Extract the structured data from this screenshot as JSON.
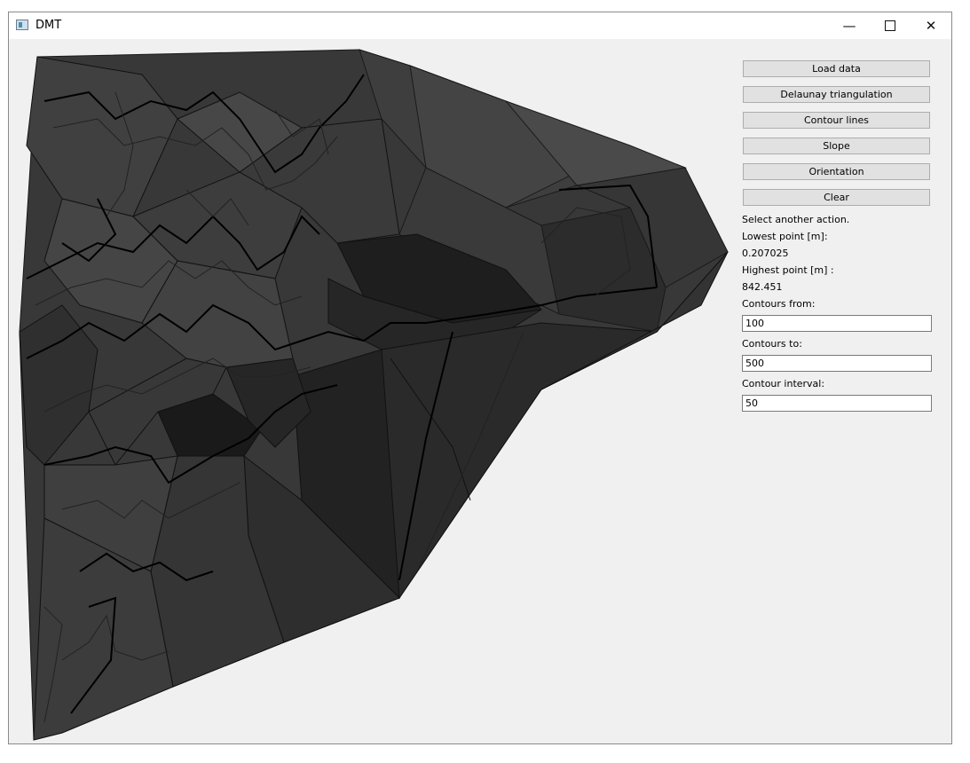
{
  "window": {
    "title": "DMT",
    "icon": "app-window-icon"
  },
  "controls": {
    "minimize_icon": "minimize-icon",
    "maximize_icon": "maximize-icon",
    "close_icon": "close-icon"
  },
  "buttons": {
    "load_data": "Load data",
    "delaunay": "Delaunay triangulation",
    "contours": "Contour lines",
    "slope": "Slope",
    "orientation": "Orientation",
    "clear": "Clear"
  },
  "status": "Select another action.",
  "lowest": {
    "label": "Lowest point [m]:",
    "value": "0.207025"
  },
  "highest": {
    "label": "Highest point [m] :",
    "value": "842.451"
  },
  "contours_from": {
    "label": "Contours from:",
    "value": "100"
  },
  "contours_to": {
    "label": "Contours to:",
    "value": "500"
  },
  "contour_interval": {
    "label": "Contour interval:",
    "value": "50"
  },
  "colors": {
    "background": "#f0f0f0",
    "terrain_dark": "#1c1c1c",
    "terrain_light": "#4a4a4a",
    "contour": "#000000"
  }
}
